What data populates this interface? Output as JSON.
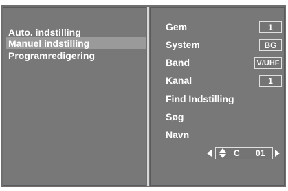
{
  "left_menu": {
    "items": [
      {
        "label": "Auto. indstilling",
        "selected": false
      },
      {
        "label": "Manuel indstilling",
        "selected": true
      },
      {
        "label": "Programredigering",
        "selected": false
      }
    ]
  },
  "settings": {
    "store": {
      "label": "Gem",
      "value": "1"
    },
    "system": {
      "label": "System",
      "value": "BG"
    },
    "band": {
      "label": "Band",
      "value": "V/UHF"
    },
    "channel": {
      "label": "Kanal",
      "value": "1"
    },
    "fine_tune": {
      "label": "Find Indstilling"
    },
    "search": {
      "label": "Søg"
    },
    "name": {
      "label": "Navn",
      "char": "C",
      "number": "01"
    }
  },
  "colors": {
    "panel": "#787878",
    "selected_row": "#9a9a9a",
    "text": "#ffffff"
  }
}
